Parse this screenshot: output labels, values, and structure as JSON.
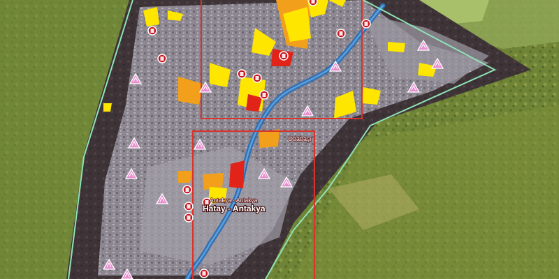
{
  "map": {
    "type": "satellite damage assessment map",
    "place_labels": {
      "main_city": "Hatay - Antakya",
      "secondary": "Antakya - Antakya",
      "district": "Odabaşı"
    },
    "colors": {
      "terrain_green": "#6f8a36",
      "terrain_olive": "#9aa24e",
      "urban_gray": "#8e8a94",
      "mask_dark": "#3d3338",
      "river_blue": "#2f6fb5",
      "boundary_green": "#8fe3b6",
      "frame_red": "#d9342b",
      "damage_yellow": "#ffe600",
      "damage_orange": "#f2a01c",
      "damage_red": "#e2231a",
      "marker_red": "#c8141e",
      "marker_pink": "#e88fd0"
    },
    "icons": [
      "damage-marker-red-icon",
      "affected-site-pink-icon"
    ]
  }
}
